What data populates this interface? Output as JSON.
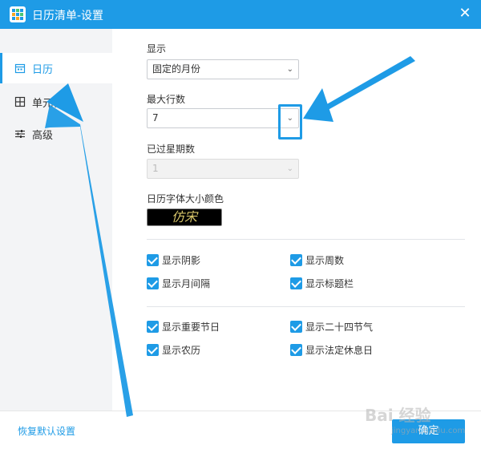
{
  "window": {
    "title": "日历清单-设置",
    "close_symbol": "✕",
    "accent": "#1e9be6"
  },
  "sidebar": {
    "items": [
      {
        "label": "日历",
        "icon": "calendar-icon",
        "active": true
      },
      {
        "label": "单元格",
        "icon": "grid-icon",
        "active": false
      },
      {
        "label": "高级",
        "icon": "sliders-icon",
        "active": false
      }
    ]
  },
  "settings": {
    "display": {
      "label": "显示",
      "value": "固定的月份"
    },
    "max_rows": {
      "label": "最大行数",
      "value": "7"
    },
    "past_weeks": {
      "label": "已过星期数",
      "value": "1",
      "disabled": true
    },
    "font_color": {
      "label": "日历字体大小颜色",
      "preview_text": "仿宋"
    }
  },
  "checkboxes": {
    "group1": [
      {
        "label": "显示阴影",
        "checked": true
      },
      {
        "label": "显示周数",
        "checked": true
      },
      {
        "label": "显示月间隔",
        "checked": true
      },
      {
        "label": "显示标题栏",
        "checked": true
      }
    ],
    "group2": [
      {
        "label": "显示重要节日",
        "checked": true
      },
      {
        "label": "显示二十四节气",
        "checked": true
      },
      {
        "label": "显示农历",
        "checked": true
      },
      {
        "label": "显示法定休息日",
        "checked": true
      }
    ]
  },
  "footer": {
    "restore_label": "恢复默认设置",
    "ok_label": "确定"
  },
  "watermark": {
    "text": "Bai 经验",
    "sub": "jingyan.baidu.com"
  }
}
